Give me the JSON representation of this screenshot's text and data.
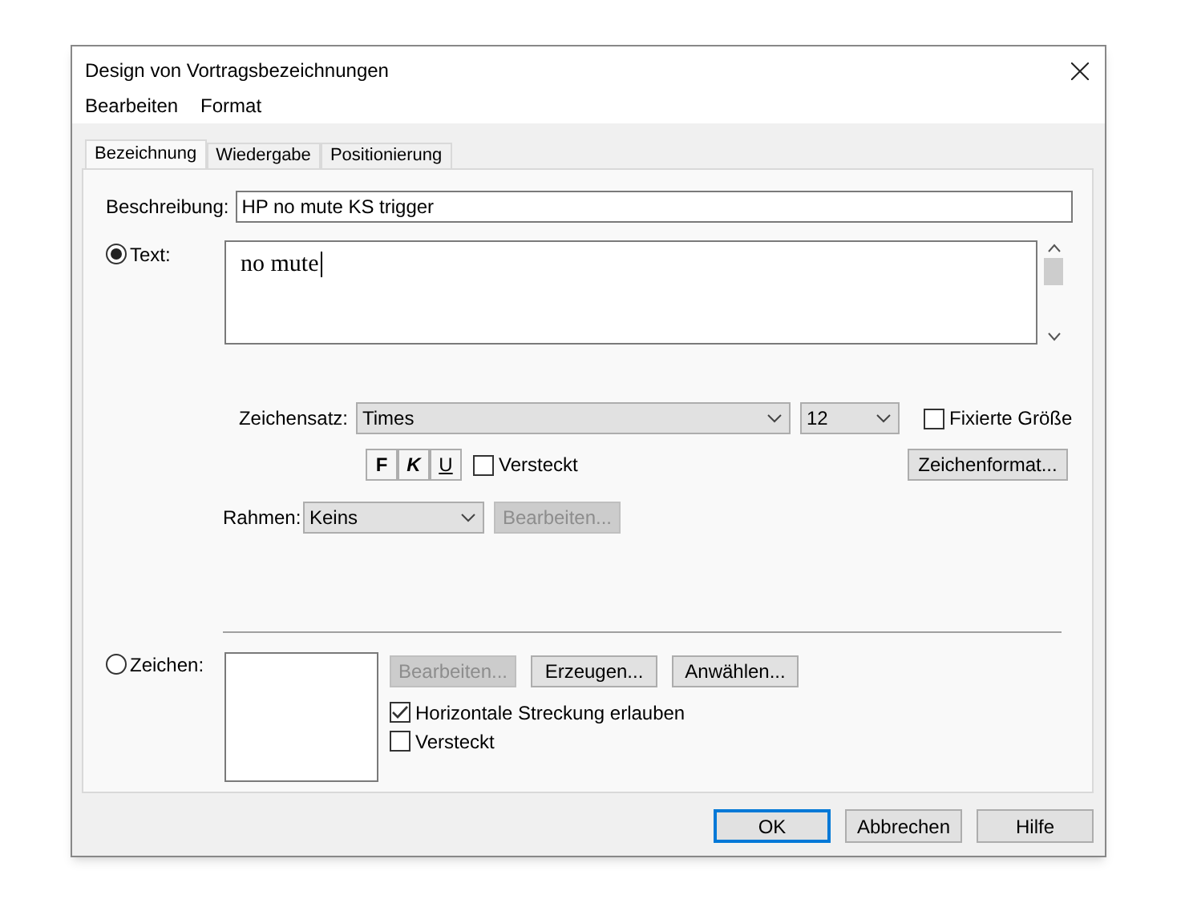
{
  "window": {
    "title": "Design von Vortragsbezeichnungen"
  },
  "menu": [
    "Bearbeiten",
    "Format"
  ],
  "tabs": [
    {
      "label": "Bezeichnung",
      "selected": true
    },
    {
      "label": "Wiedergabe",
      "selected": false
    },
    {
      "label": "Positionierung",
      "selected": false
    }
  ],
  "description": {
    "label": "Beschreibung:",
    "value": "HP no mute KS trigger"
  },
  "text_option": {
    "label": "Text:",
    "selected": true,
    "value": "no mute"
  },
  "font": {
    "label": "Zeichensatz:",
    "value": "Times",
    "size": "12",
    "fixed_size": {
      "label": "Fixierte Größe",
      "checked": false
    }
  },
  "style_buttons": [
    {
      "label": "F",
      "kind": "bold"
    },
    {
      "label": "K",
      "kind": "italic"
    },
    {
      "label": "U",
      "kind": "underline"
    }
  ],
  "hidden_text": {
    "label": "Versteckt",
    "checked": false
  },
  "char_format_button": "Zeichenformat...",
  "frame": {
    "label": "Rahmen:",
    "value": "Keins",
    "button": {
      "label": "Bearbeiten...",
      "disabled": true
    }
  },
  "symbol_option": {
    "label": "Zeichen:",
    "selected": false
  },
  "symbol_buttons": [
    {
      "label": "Bearbeiten...",
      "disabled": true
    },
    {
      "label": "Erzeugen...",
      "disabled": false
    },
    {
      "label": "Anwählen...",
      "disabled": false
    }
  ],
  "symbol_checks": [
    {
      "label": "Horizontale Streckung erlauben",
      "checked": true
    },
    {
      "label": "Versteckt",
      "checked": false
    }
  ],
  "footer_buttons": [
    {
      "label": "OK",
      "default": true
    },
    {
      "label": "Abbrechen",
      "default": false
    },
    {
      "label": "Hilfe",
      "default": false
    }
  ]
}
